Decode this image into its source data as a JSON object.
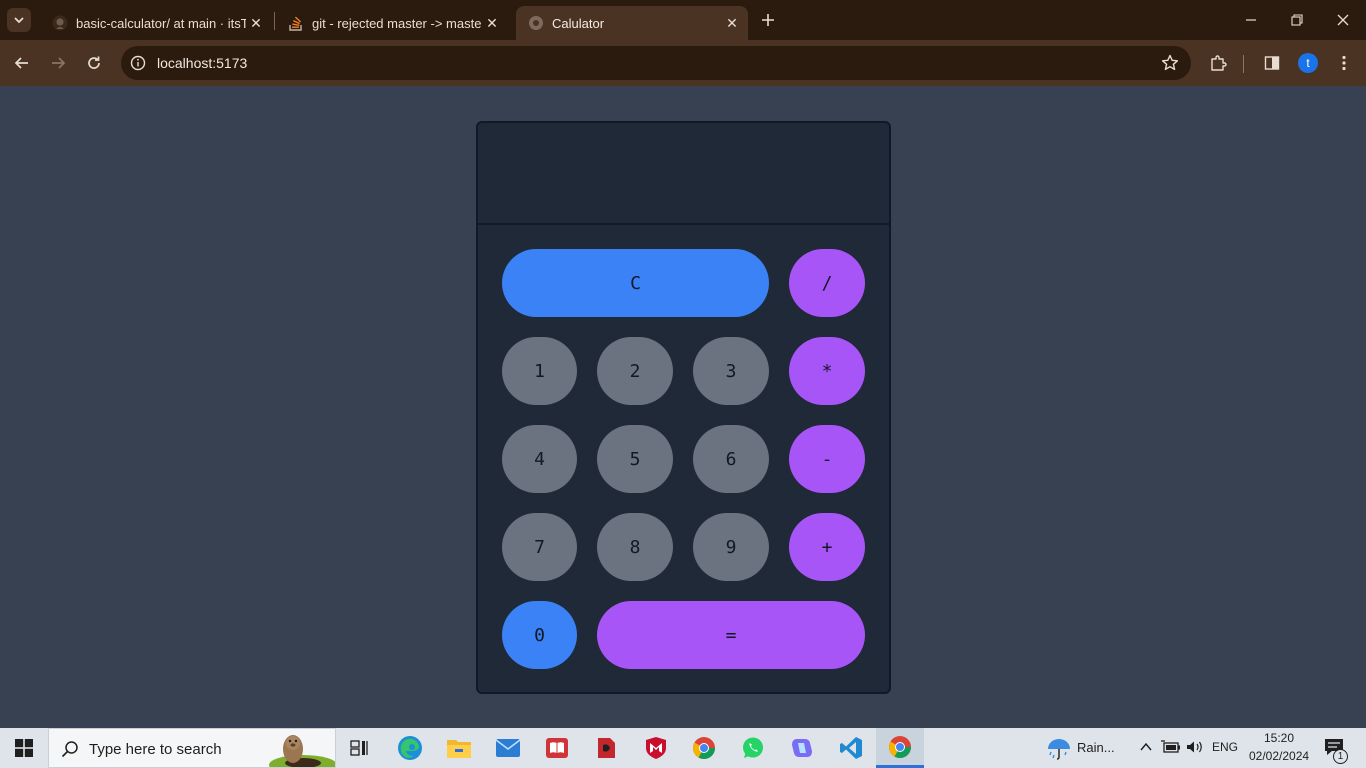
{
  "browser": {
    "tabs": [
      {
        "title": "basic-calculator/ at main · itsTQ",
        "icon": "github-icon"
      },
      {
        "title": "git - rejected master -> master",
        "icon": "stackoverflow-icon"
      },
      {
        "title": "Calulator",
        "icon": "page-icon",
        "active": true
      }
    ],
    "url": "localhost:5173",
    "profile_initial": "t"
  },
  "calculator": {
    "display": "",
    "keys": {
      "clear": "C",
      "divide": "/",
      "one": "1",
      "two": "2",
      "three": "3",
      "multiply": "*",
      "four": "4",
      "five": "5",
      "six": "6",
      "subtract": "-",
      "seven": "7",
      "eight": "8",
      "nine": "9",
      "add": "+",
      "zero": "0",
      "equals": "="
    },
    "colors": {
      "page_bg": "#374151",
      "panel_bg": "#1f2937",
      "digit_key": "#6b7280",
      "clear_key": "#3b82f6",
      "operator_key": "#a855f7"
    }
  },
  "taskbar": {
    "search_placeholder": "Type here to search",
    "weather": "Rain...",
    "language": "ENG",
    "time": "15:20",
    "date": "02/02/2024",
    "notification_count": "1"
  }
}
